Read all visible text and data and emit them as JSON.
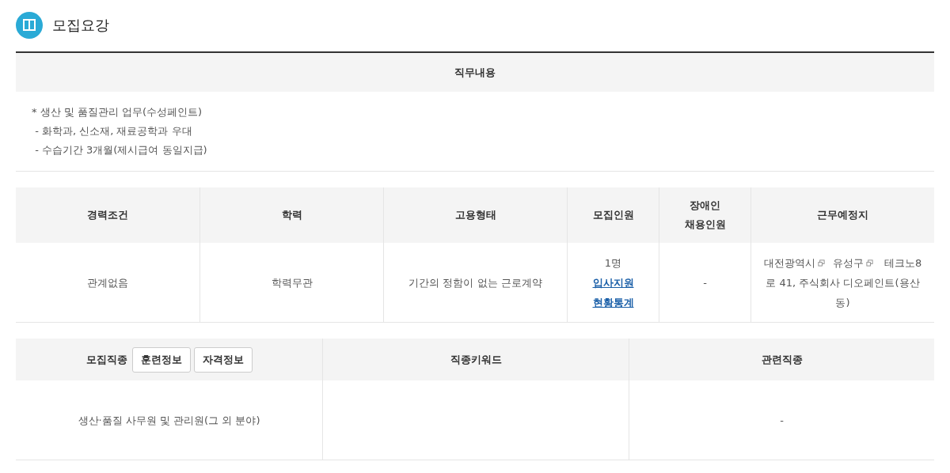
{
  "section": {
    "title": "모집요강"
  },
  "job_content": {
    "heading": "직무내용",
    "lines": [
      "* 생산 및 품질관리 업무(수성페인트)",
      " - 화학과, 신소재, 재료공학과 우대",
      " - 수습기간 3개월(제시급여 동일지급)"
    ]
  },
  "conditions": {
    "columns": [
      "경력조건",
      "학력",
      "고용형태",
      "모집인원",
      "장애인\n채용인원",
      "근무예정지"
    ],
    "experience": "관계없음",
    "education": "학력무관",
    "employment": "기간의 정함이 없는 근로계약",
    "headcount": "1명",
    "stats_link": "입사지원\n현황통계",
    "disabled_hire": "-",
    "location": {
      "links": [
        "대전광역시",
        "유성구"
      ],
      "address": "테크노8로 41, 주식회사 디오페인트(용산동)"
    }
  },
  "occupation": {
    "heading": "모집직종",
    "buttons": [
      "훈련정보",
      "자격정보"
    ],
    "columns": [
      "직종키워드",
      "관련직종"
    ],
    "job": "생산·품질 사무원 및 관리원(그 외 분야)",
    "related": "-"
  }
}
